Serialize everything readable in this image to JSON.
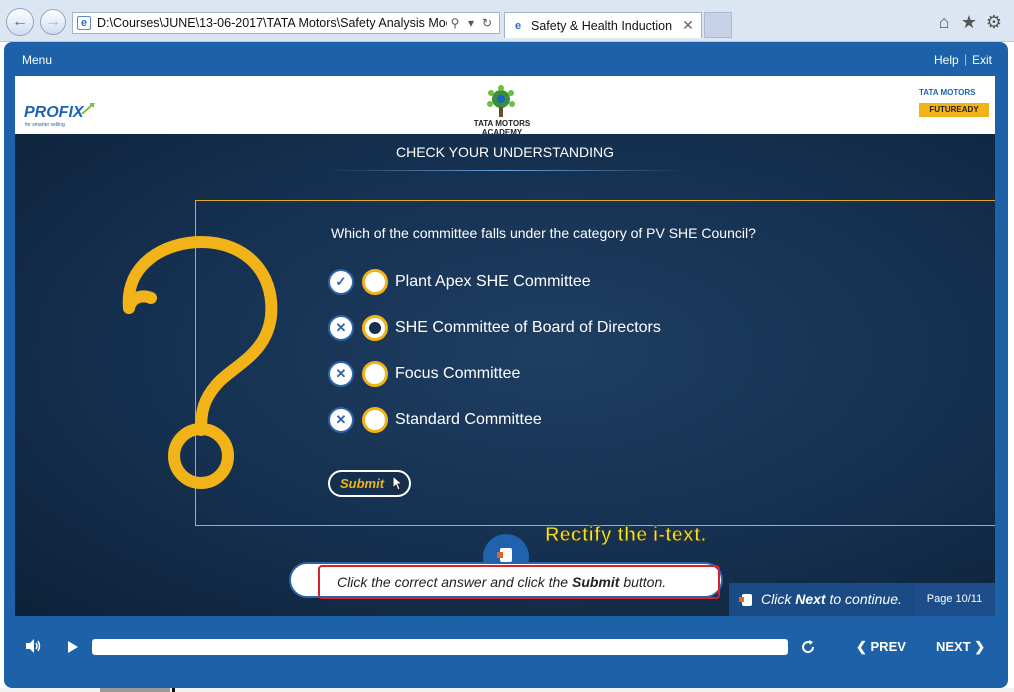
{
  "browser": {
    "address": "D:\\Courses\\JUNE\\13-06-2017\\TATA Motors\\Safety Analysis Modu",
    "tab_title": "Safety & Health Induction",
    "tab_close": "✕",
    "icons": [
      "back-icon",
      "forward-icon",
      "search-icon",
      "dropdown-icon",
      "refresh-icon",
      "home-icon",
      "star-icon",
      "gear-icon"
    ]
  },
  "topbar": {
    "menu_label": "Menu",
    "help_label": "Help",
    "separator": "|",
    "exit_label": "Exit"
  },
  "logos": {
    "left_brand": "PROFIX",
    "left_tagline": "for smarter selling",
    "center_caption": "TATA MOTORS ACADEMY",
    "right_brand": "TATA MOTORS",
    "right_badge": "FUTUREADY"
  },
  "quiz": {
    "section_title": "CHECK YOUR UNDERSTANDING",
    "question": "Which of the committee falls under the category of PV SHE Council?",
    "options": [
      {
        "label": "Plant Apex SHE Committee",
        "feedback": "correct",
        "feedback_icon": "check-icon",
        "selected": false
      },
      {
        "label": "SHE Committee of Board of Directors",
        "feedback": "incorrect",
        "feedback_icon": "cross-icon",
        "selected": true
      },
      {
        "label": "Focus Committee",
        "feedback": "incorrect",
        "feedback_icon": "cross-icon",
        "selected": false
      },
      {
        "label": "Standard Committee",
        "feedback": "incorrect",
        "feedback_icon": "cross-icon",
        "selected": false
      }
    ],
    "submit_label": "Submit"
  },
  "annotation": {
    "note": "Rectify the i-text."
  },
  "instruction": {
    "prefix": "Click the correct answer and click the ",
    "bold": "Submit",
    "suffix": " button."
  },
  "continue": {
    "prefix": "Click ",
    "bold": "Next",
    "suffix": " to continue."
  },
  "page_indicator": "Page 10/11",
  "player": {
    "prev_label": "PREV",
    "next_label": "NEXT",
    "progress": 0.0
  },
  "colors": {
    "frame_blue": "#1d62a9",
    "accent_yellow": "#f2b318",
    "stage_dark": "#15304f",
    "error_red": "#d3232e"
  }
}
